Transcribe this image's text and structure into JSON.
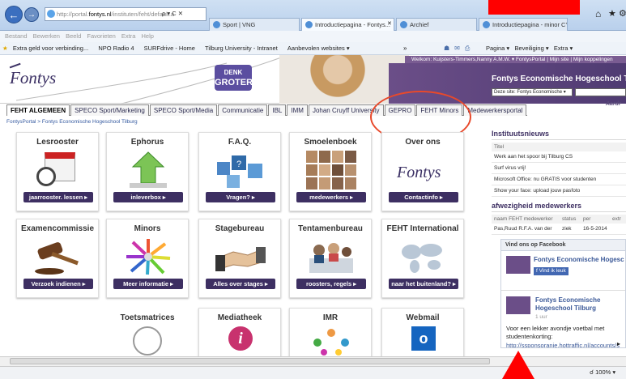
{
  "browser": {
    "url_prefix": "http://portal.",
    "url_domain": "fontys.nl",
    "url_suffix": "/instituten/feht/default.a",
    "addr_controls": "ρ ▾ C ✕",
    "tabs": [
      "Sport | VNG",
      "Introductiepagina - Fontys...",
      "Archief",
      "Introductiepagina - minor CY..."
    ],
    "tab_close": "✕",
    "menu": [
      "Bestand",
      "Bewerken",
      "Beeld",
      "Favorieten",
      "Extra",
      "Help"
    ],
    "favorites": [
      "Extra geld voor verbinding...",
      "NPO Radio 4",
      "SURFdrive - Home",
      "Tilburg University - Intranet",
      "Aanbevolen websites ▾"
    ],
    "cmdbar": [
      "Pagina ▾",
      "Beveiliging ▾",
      "Extra ▾"
    ],
    "zoom": "100%",
    "overflow_chevron": "»"
  },
  "site": {
    "logo": "Fontys",
    "denk_line1": "DENK",
    "denk_line2": "GROTER",
    "welcome": "Welkom: Kuijsters-Timmers,Nanny A.M.W. ▾   FontysPortal  |  Mijn site  |  Mijn koppelingen",
    "title": "Fontys Economische Hogeschool Tilburg",
    "search_scope": "Deze site: Fontys Economische ▾",
    "aardr": "Aardr",
    "nav": [
      "FEHT ALGEMEEN",
      "SPECO Sport/Marketing",
      "SPECO Sport/Media",
      "Communicatie",
      "IBL",
      "IMM",
      "Johan Cruyff University",
      "GEPRO",
      "FEHT Minors",
      "Medewerkersportal"
    ],
    "breadcrumb": "FontysPortal  >  Fontys Economische Hogeschool Tilburg"
  },
  "tiles": [
    {
      "title": "Lesrooster",
      "button": "jaarrooster. lessen ▸"
    },
    {
      "title": "Ephorus",
      "button": "inleverbox     ▸"
    },
    {
      "title": "F.A.Q.",
      "button": "Vragen?     ▸"
    },
    {
      "title": "Smoelenboek",
      "button": "medewerkers  ▸"
    },
    {
      "title": "Over ons",
      "logo": "Fontys",
      "button": "Contactinfo  ▸"
    },
    {
      "title": "Examencommissie",
      "button": "Verzoek indienen ▸"
    },
    {
      "title": "Minors",
      "button": "Meer informatie  ▸"
    },
    {
      "title": "Stagebureau",
      "button": "Alles over stages ▸"
    },
    {
      "title": "Tentamenbureau",
      "button": "roosters, regels ▸"
    },
    {
      "title": "FEHT International",
      "button": "naar het buitenland? ▸"
    },
    {
      "title": "Toetsmatrices"
    },
    {
      "title": "Mediatheek"
    },
    {
      "title": "IMR"
    },
    {
      "title": "Webmail"
    }
  ],
  "news": {
    "header": "Instituutsnieuws",
    "col": "Titel",
    "items": [
      "Werk aan het spoor bij Tilburg CS",
      "Surf virus vrij!",
      "Microsoft Office: nu GRATIS voor studenten",
      "Show your face: upload jouw pasfoto"
    ]
  },
  "absence": {
    "header": "afwezigheid medewerkers",
    "cols": [
      "naam FEHT medewerker",
      "status",
      "per",
      "extr"
    ],
    "row": [
      "Pas,Ruud R.F.A. van der",
      "ziek",
      "16-5-2014"
    ]
  },
  "facebook": {
    "header": "Vind ons op Facebook",
    "page": "Fontys Economische Hogeschool Tilburg",
    "like": "Vind ik leuk",
    "post_page": "Fontys Economische Hogeschool Tilburg",
    "post_time": "1 uur",
    "post_text": "Voor een lekker avondje voetbal met studentenkorting:",
    "post_link": "http://ssponsoranje.hottraffic.nl/accounts/s"
  },
  "colors": {
    "brand": "#3d2f62",
    "annotation": "#e8492b"
  }
}
